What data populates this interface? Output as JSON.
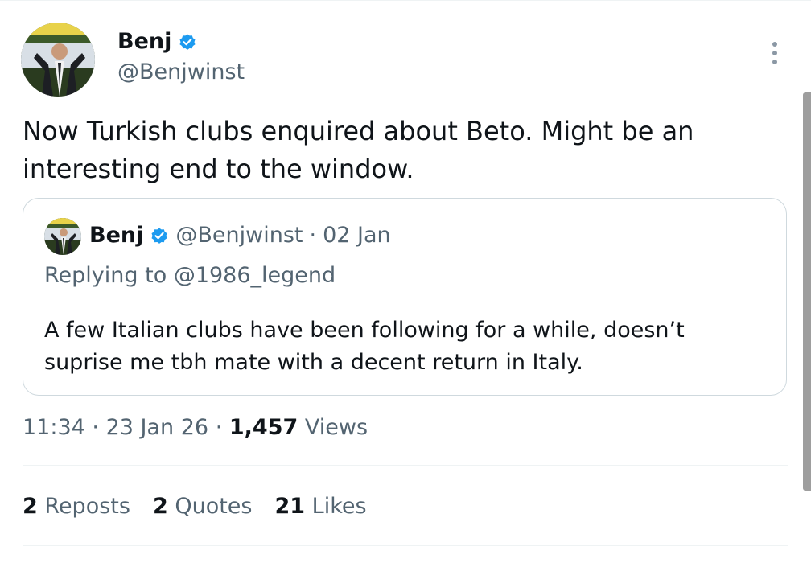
{
  "author": {
    "name": "Benj",
    "handle": "@Benjwinst",
    "verified": true,
    "avatar_icon": "profile-photo"
  },
  "menu_icon": "more-vertical-icon",
  "tweet": {
    "text": "Now Turkish clubs enquired about Beto. Might be an interesting end to the window."
  },
  "quote": {
    "name": "Benj",
    "handle": "@Benjwinst",
    "separator": "·",
    "date": "02 Jan",
    "reply_prefix": "Replying to",
    "reply_to": "@1986_legend",
    "text": "A few Italian clubs have been following for a while, doesn’t suprise me tbh mate with a decent return in Italy."
  },
  "meta": {
    "time": "11:34",
    "separator": "·",
    "date": "23 Jan 26",
    "views_count": "1,457",
    "views_label": "Views"
  },
  "stats": {
    "reposts_count": "2",
    "reposts_label": "Reposts",
    "quotes_count": "2",
    "quotes_label": "Quotes",
    "likes_count": "21",
    "likes_label": "Likes"
  },
  "colors": {
    "verified_blue": "#1d9bf0",
    "secondary_text": "#536471",
    "primary_text": "#0f1419",
    "border": "#cfd9de"
  }
}
